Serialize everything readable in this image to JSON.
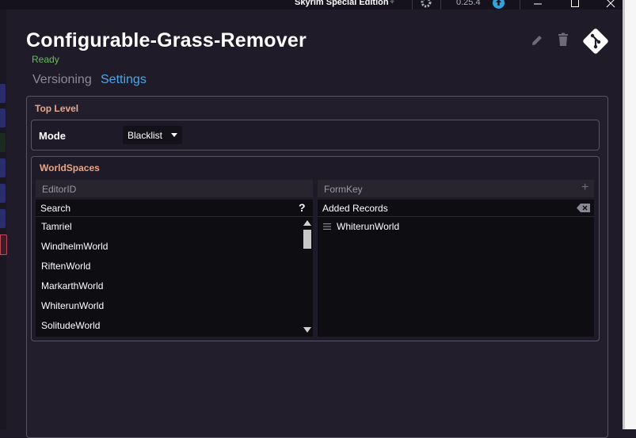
{
  "titlebar": {
    "game": "Skyrim Special Edition",
    "version": "0.25.4"
  },
  "header": {
    "title": "Configurable-Grass-Remover",
    "status": "Ready",
    "tabs": [
      {
        "label": "Versioning",
        "active": false
      },
      {
        "label": "Settings",
        "active": true
      }
    ]
  },
  "top_level": {
    "title": "Top Level",
    "mode_label": "Mode",
    "mode_value": "Blacklist"
  },
  "worldspaces": {
    "title": "WorldSpaces",
    "left_column": {
      "header": "EditorID",
      "search_label": "Search",
      "items": [
        "Tamriel",
        "WindhelmWorld",
        "RiftenWorld",
        "MarkarthWorld",
        "WhiterunWorld",
        "SolitudeWorld"
      ]
    },
    "right_column": {
      "header": "FormKey",
      "added_label": "Added Records",
      "items": [
        "WhiterunWorld"
      ]
    }
  },
  "colors": {
    "accent": "#4ea6e6",
    "status": "#62c24f",
    "section_title": "#e8a78a",
    "background": "#1f1b29"
  }
}
